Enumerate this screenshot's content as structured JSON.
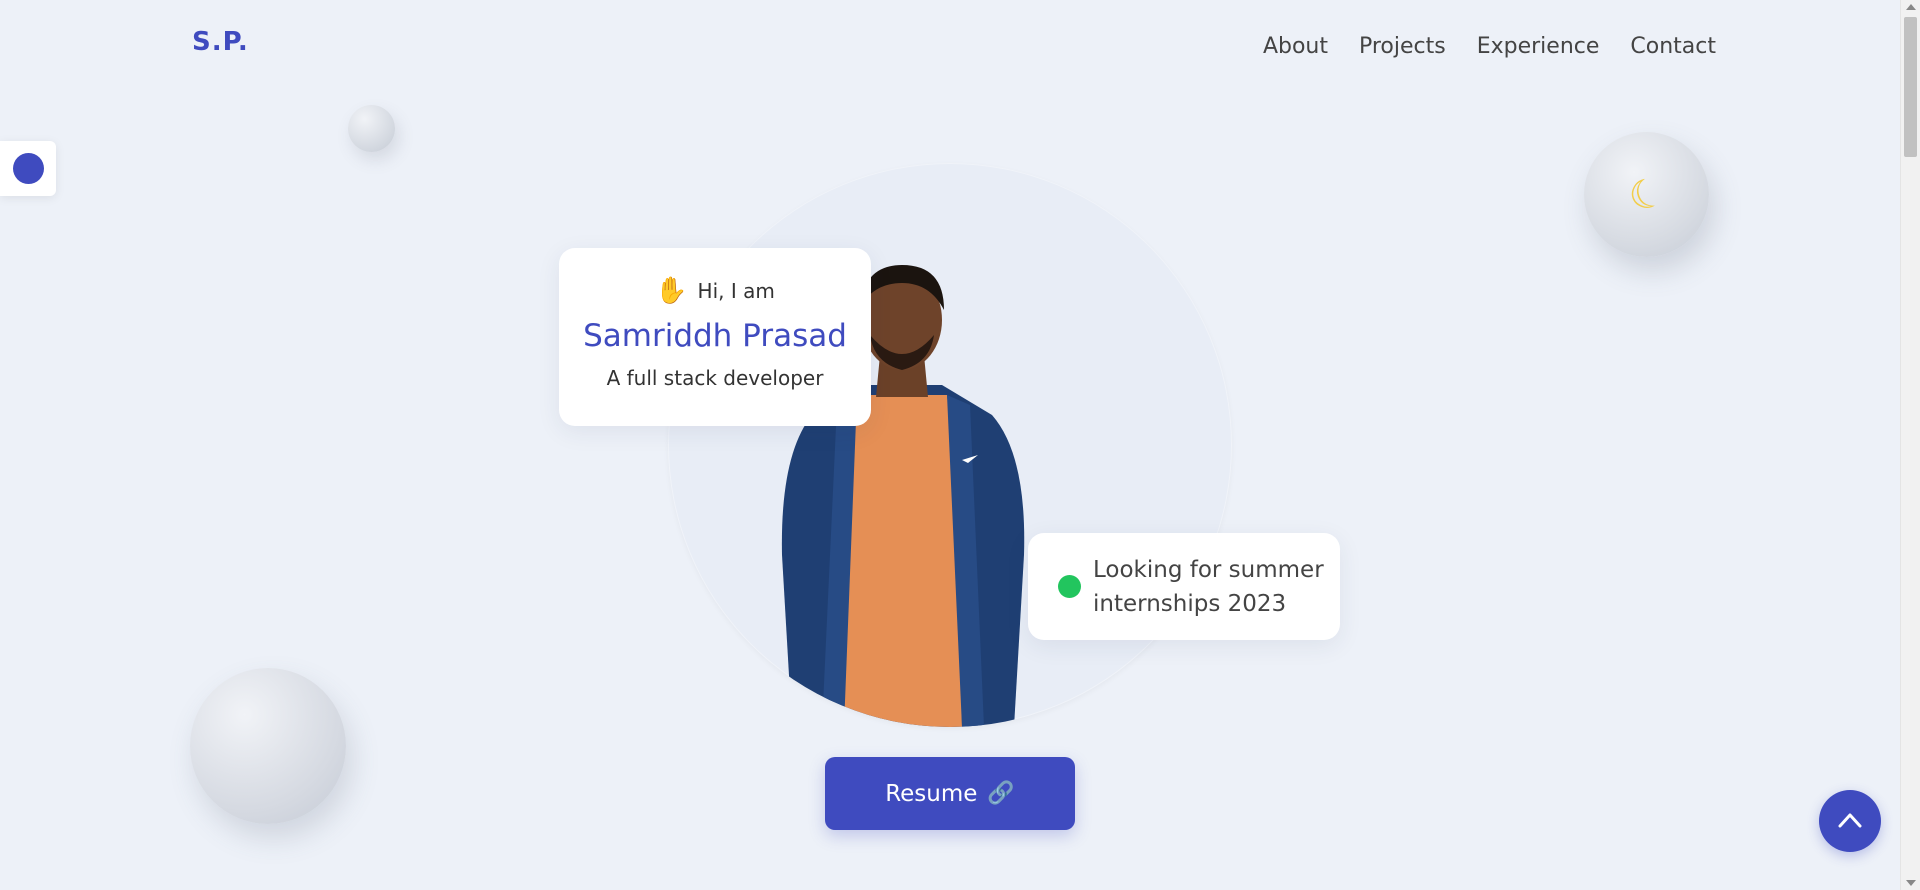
{
  "header": {
    "logo": "S.P.",
    "nav": [
      {
        "label": "About"
      },
      {
        "label": "Projects"
      },
      {
        "label": "Experience"
      },
      {
        "label": "Contact"
      }
    ]
  },
  "hero": {
    "greeting": "Hi, I am",
    "name": "Samriddh Prasad",
    "role": "A full stack developer",
    "status_line1": "Looking for summer",
    "status_line2": "internships 2023",
    "resume_label": "Resume"
  },
  "icons": {
    "wave": "waving-hand-icon",
    "moon": "moon-icon",
    "link": "link-icon",
    "scroll_top": "chevron-up-icon"
  },
  "colors": {
    "accent": "#3f4bbf",
    "status": "#22c55e",
    "background": "#edf1f8"
  }
}
